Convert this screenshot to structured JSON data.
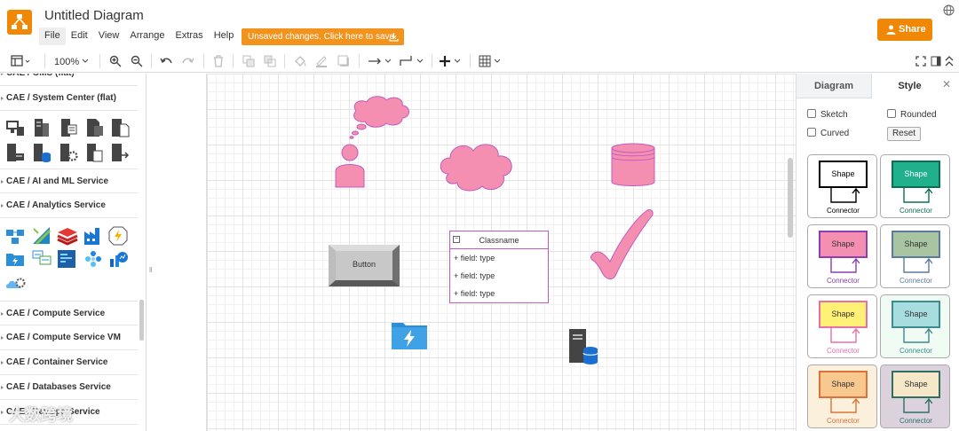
{
  "app": {
    "title": "Untitled Diagram",
    "menu": [
      {
        "label": "File"
      },
      {
        "label": "Edit"
      },
      {
        "label": "View"
      },
      {
        "label": "Arrange"
      },
      {
        "label": "Extras"
      },
      {
        "label": "Help"
      }
    ],
    "unsaved_notice": "Unsaved changes. Click here to save.",
    "share_label": "Share",
    "accent_color": "#f08705"
  },
  "toolbar": {
    "zoom": "100%"
  },
  "sidebar": {
    "sections": [
      {
        "label": "CAE / OMS (flat)"
      },
      {
        "label": "CAE / System Center (flat)"
      },
      {
        "label": "CAE / AI and ML Service"
      },
      {
        "label": "CAE / Analytics Service"
      },
      {
        "label": "CAE / Compute Service"
      },
      {
        "label": "CAE / Compute Service VM"
      },
      {
        "label": "CAE / Container Service"
      },
      {
        "label": "CAE / Databases Service"
      },
      {
        "label": "CAE / DevOps Service"
      }
    ]
  },
  "canvas": {
    "button_label": "Button",
    "class_title": "Classname",
    "class_fields": [
      "+ field: type",
      "+ field: type",
      "+ field: type"
    ],
    "shape_fill": "#f48fb1",
    "shape_stroke": "#c05bc0"
  },
  "panel": {
    "tabs": [
      "Diagram",
      "Style"
    ],
    "options": {
      "sketch": "Sketch",
      "rounded": "Rounded",
      "curved": "Curved",
      "reset": "Reset"
    },
    "styles": [
      {
        "shape": "Shape",
        "connector": "Connector",
        "fill": "#ffffff",
        "stroke": "#000000",
        "text": "#000000",
        "bg": "#ffffff"
      },
      {
        "shape": "Shape",
        "connector": "Connector",
        "fill": "#21b08c",
        "stroke": "#0d6e55",
        "text": "#ffffff",
        "bg": "#ffffff"
      },
      {
        "shape": "Shape",
        "connector": "Connector",
        "fill": "#f48fb1",
        "stroke": "#8c3fb0",
        "text": "#333333",
        "bg": "#ffffff"
      },
      {
        "shape": "Shape",
        "connector": "Connector",
        "fill": "#a9c4a0",
        "stroke": "#5c7a9e",
        "text": "#333333",
        "bg": "#ffffff"
      },
      {
        "shape": "Shape",
        "connector": "Connector",
        "fill": "#fff176",
        "stroke": "#e86fa8",
        "text": "#333333",
        "bg": "#ffffff"
      },
      {
        "shape": "Shape",
        "connector": "Connector",
        "fill": "#a8dde0",
        "stroke": "#3b8b8f",
        "text": "#333333",
        "bg": "#f0fbf4"
      },
      {
        "shape": "Shape",
        "connector": "Connector",
        "fill": "#f8c88e",
        "stroke": "#d9733b",
        "text": "#333333",
        "bg": "#fbf0dc"
      },
      {
        "shape": "Shape",
        "connector": "Connector",
        "fill": "#f6e7c8",
        "stroke": "#2f6f62",
        "text": "#333333",
        "bg": "#dcd2de"
      }
    ]
  },
  "watermark": "大数跨境"
}
